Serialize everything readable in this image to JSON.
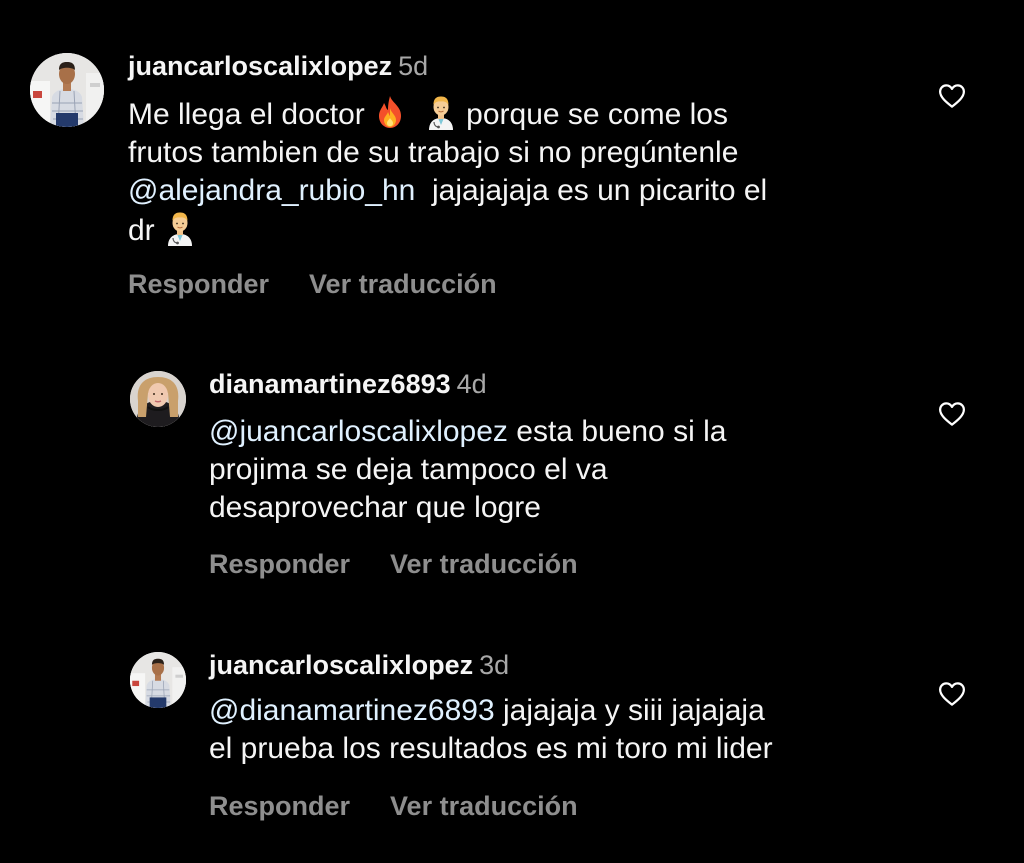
{
  "comments": [
    {
      "username": "juancarloscalixlopez",
      "time": "5d",
      "body": {
        "t1": "Me llega el doctor",
        "emoji1": "fire-emoji",
        "emoji2": "health-worker-man-emoji",
        "t2": "porque se come los",
        "line2": "frutos tambien de su trabajo si no pregúntenle",
        "mention": "@alejandra_rubio_hn",
        "t3": "jajajajaja es un picarito el",
        "line4": "dr",
        "emoji3": "health-worker-man-emoji"
      },
      "reply_label": "Responder",
      "translate_label": "Ver traducción",
      "like_icon": "heart-outline-icon"
    },
    {
      "username": "dianamartinez6893",
      "time": "4d",
      "body": {
        "mention": "@juancarloscalixlopez",
        "t1": "esta bueno si la",
        "line2": "projima se deja tampoco el va",
        "line3": "desaprovechar que logre"
      },
      "reply_label": "Responder",
      "translate_label": "Ver traducción",
      "like_icon": "heart-outline-icon"
    },
    {
      "username": "juancarloscalixlopez",
      "time": "3d",
      "body": {
        "mention": "@dianamartinez6893",
        "t1": "jajajaja y siii jajajaja",
        "line2": "el prueba los resultados es mi toro mi lider"
      },
      "reply_label": "Responder",
      "translate_label": "Ver traducción",
      "like_icon": "heart-outline-icon"
    }
  ],
  "colors": {
    "background": "#000000",
    "text": "#f5f5f5",
    "mention": "#e0f1ff",
    "secondary": "#a8a8a8",
    "action": "#8e8e8e"
  }
}
